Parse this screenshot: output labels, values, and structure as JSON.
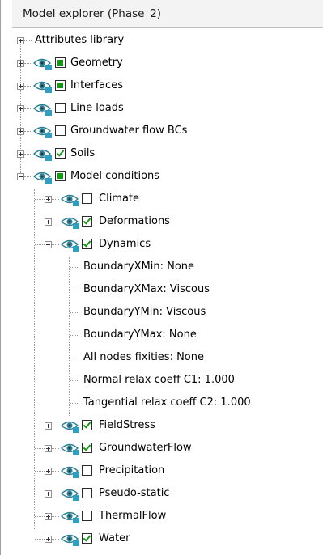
{
  "panel": {
    "title": "Model explorer (Phase_2)"
  },
  "tree": {
    "attributes_library": "Attributes library",
    "geometry": "Geometry",
    "interfaces": "Interfaces",
    "line_loads": "Line loads",
    "groundwater_flow_bcs": "Groundwater flow BCs",
    "soils": "Soils",
    "model_conditions": "Model conditions",
    "climate": "Climate",
    "deformations": "Deformations",
    "dynamics": "Dynamics",
    "dyn": {
      "bxmin": "BoundaryXMin: None",
      "bxmax": "BoundaryXMax: Viscous",
      "bymin": "BoundaryYMin: Viscous",
      "bymax": "BoundaryYMax: None",
      "fixities": "All nodes fixities: None",
      "c1": "Normal relax coeff C1: 1.000",
      "c2": "Tangential relax coeff C2: 1.000"
    },
    "fieldstress": "FieldStress",
    "groundwaterflow": "GroundwaterFlow",
    "precipitation": "Precipitation",
    "pseudo_static": "Pseudo-static",
    "thermalflow": "ThermalFlow",
    "water": "Water"
  },
  "colors": {
    "check_green": "#109a10",
    "eye_blue": "#2f7f93"
  }
}
